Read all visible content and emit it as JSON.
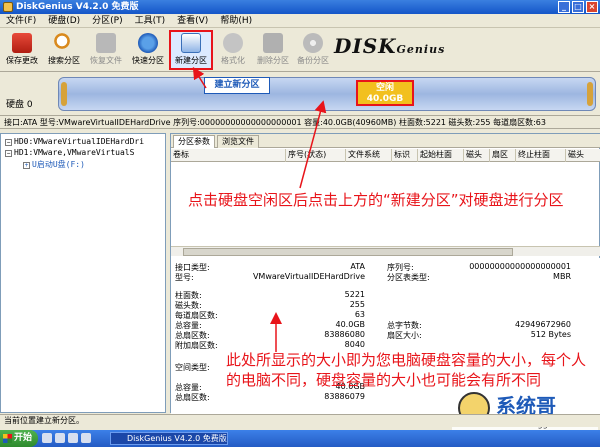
{
  "window": {
    "title": "DiskGenius V4.2.0 免费版"
  },
  "menu": [
    "文件(F)",
    "硬盘(D)",
    "分区(P)",
    "工具(T)",
    "查看(V)",
    "帮助(H)"
  ],
  "toolbar": [
    {
      "label": "保存更改",
      "icon": "save-icon",
      "disabled": false
    },
    {
      "label": "搜索分区",
      "icon": "search-icon",
      "disabled": false
    },
    {
      "label": "恢复文件",
      "icon": "recover-icon",
      "disabled": true
    },
    {
      "label": "快速分区",
      "icon": "quick-partition-icon",
      "disabled": false
    },
    {
      "label": "新建分区",
      "icon": "new-partition-icon",
      "disabled": false,
      "highlight": true
    },
    {
      "label": "格式化",
      "icon": "format-icon",
      "disabled": true
    },
    {
      "label": "删除分区",
      "icon": "delete-icon",
      "disabled": true
    },
    {
      "label": "备份分区",
      "icon": "backup-icon",
      "disabled": true
    }
  ],
  "logo": {
    "main": "DISK",
    "sub": "Genius"
  },
  "disk": {
    "label": "硬盘 0",
    "free_label": "空闲",
    "free_size": "40.0GB"
  },
  "tooltip": "建立新分区",
  "info_line": "接口:ATA  型号:VMwareVirtualIDEHardDrive  序列号:00000000000000000001  容量:40.0GB(40960MB)  柱面数:5221  磁头数:255  每道扇区数:63",
  "tree": [
    {
      "text": "HD0:VMwareVirtualIDEHardDri",
      "level": 0
    },
    {
      "text": "HD1:VMware,VMwareVirtualS",
      "level": 0
    },
    {
      "text": "U启动U盘(F:)",
      "level": 1
    }
  ],
  "tabs": [
    "分区参数",
    "浏览文件"
  ],
  "columns": [
    "卷标",
    "序号(状态)",
    "文件系统",
    "标识",
    "起始柱面",
    "磁头",
    "扇区",
    "终止柱面",
    "磁头"
  ],
  "details": {
    "interface_label": "接口类型:",
    "interface_value": "ATA",
    "serial_label": "序列号:",
    "serial_value": "00000000000000000001",
    "model_label": "型号:",
    "model_value": "VMwareVirtualIDEHardDrive",
    "ptable_label": "分区表类型:",
    "ptable_value": "MBR",
    "cyl_label": "柱面数:",
    "cyl_value": "5221",
    "heads_label": "磁头数:",
    "heads_value": "255",
    "spt_label": "每道扇区数:",
    "spt_value": "63",
    "cap_label": "总容量:",
    "cap_value": "40.0GB",
    "bytes_label": "总字节数:",
    "bytes_value": "42949672960",
    "sectors_label": "总扇区数:",
    "sectors_value": "83886080",
    "secsize_label": "扇区大小:",
    "secsize_value": "512 Bytes",
    "extra_label": "附加扇区数:",
    "extra_value": "8040",
    "space_type_label": "空间类型:",
    "cap2_label": "总容量:",
    "cap2_value": "40.0GB",
    "sectors2_label": "总扇区数:",
    "sectors2_value": "83886079"
  },
  "annotations": {
    "top": "点击硬盘空闲区后点击上方的“新建分区”对硬盘进行分区",
    "bottom": "此处所显示的大小即为您电脑硬盘容量的大小，每个人的电脑不同，硬盘容量的大小也可能会有所不同"
  },
  "statusbar": "当前位置建立新分区。",
  "taskbar": {
    "start": "开始",
    "item": "DiskGenius V4.2.0 免费版"
  },
  "watermark": {
    "brand": "系统哥",
    "site": "www.xitongge.com"
  },
  "colors": {
    "accent": "#e8141a",
    "free_space": "#f2c01e",
    "titlebar": "#1455c8"
  }
}
